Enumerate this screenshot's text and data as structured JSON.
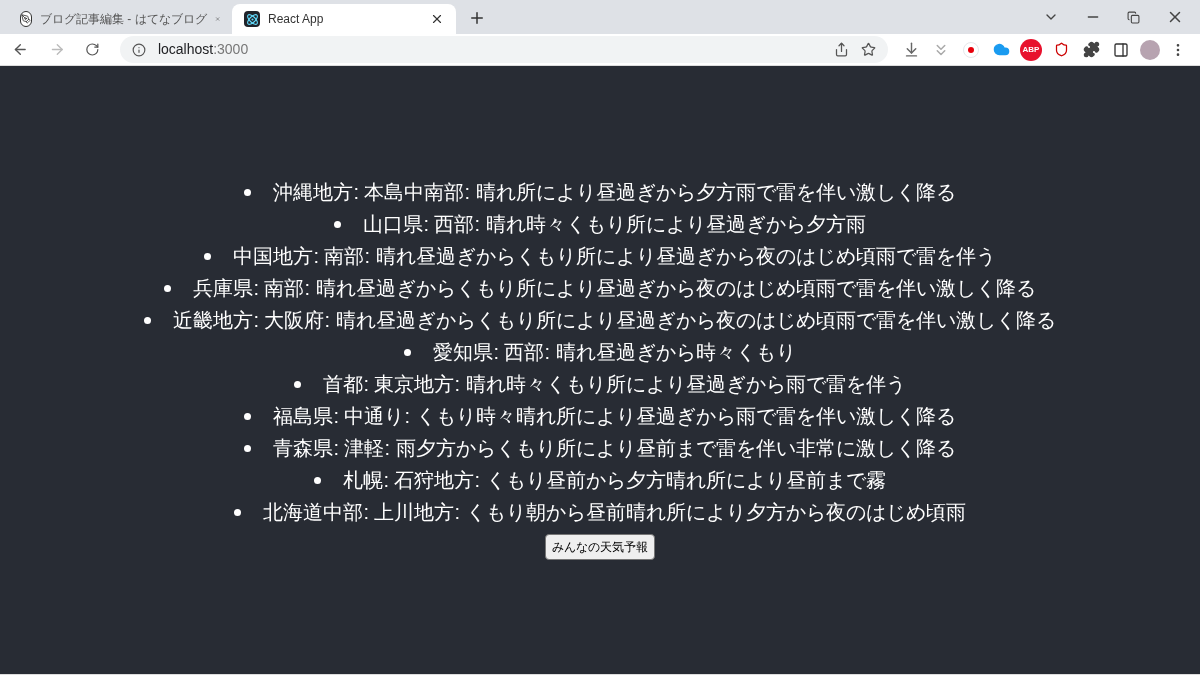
{
  "tabs": [
    {
      "title": "ブログ記事編集 - はてなブログ",
      "selected": false,
      "kind": "blog"
    },
    {
      "title": "React App",
      "selected": true,
      "kind": "react"
    }
  ],
  "address": {
    "host": "localhost",
    "port": ":3000"
  },
  "extensions": [
    {
      "kind": "download"
    },
    {
      "kind": "arrows"
    },
    {
      "kind": "record"
    },
    {
      "kind": "cloud"
    },
    {
      "kind": "abp",
      "label": "ABP"
    },
    {
      "kind": "shield"
    },
    {
      "kind": "puzzle"
    }
  ],
  "forecasts": [
    "沖縄地方: 本島中南部: 晴れ所により昼過ぎから夕方雨で雷を伴い激しく降る",
    "山口県: 西部: 晴れ時々くもり所により昼過ぎから夕方雨",
    "中国地方: 南部: 晴れ昼過ぎからくもり所により昼過ぎから夜のはじめ頃雨で雷を伴う",
    "兵庫県: 南部: 晴れ昼過ぎからくもり所により昼過ぎから夜のはじめ頃雨で雷を伴い激しく降る",
    "近畿地方: 大阪府: 晴れ昼過ぎからくもり所により昼過ぎから夜のはじめ頃雨で雷を伴い激しく降る",
    "愛知県: 西部: 晴れ昼過ぎから時々くもり",
    "首都: 東京地方: 晴れ時々くもり所により昼過ぎから雨で雷を伴う",
    "福島県: 中通り: くもり時々晴れ所により昼過ぎから雨で雷を伴い激しく降る",
    "青森県: 津軽: 雨夕方からくもり所により昼前まで雷を伴い非常に激しく降る",
    "札幌: 石狩地方: くもり昼前から夕方晴れ所により昼前まで霧",
    "北海道中部: 上川地方: くもり朝から昼前晴れ所により夕方から夜のはじめ頃雨"
  ],
  "button": "みんなの天気予報"
}
